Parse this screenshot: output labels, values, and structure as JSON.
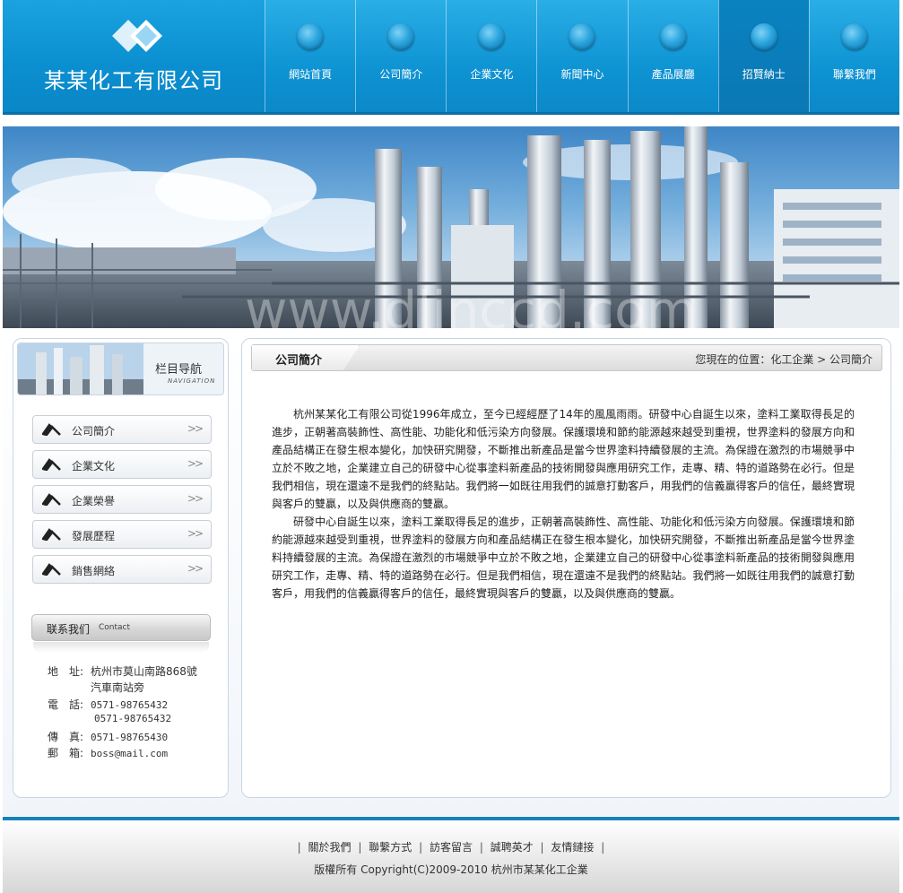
{
  "header": {
    "company_name": "某某化工有限公司",
    "nav": [
      {
        "label": "網站首頁"
      },
      {
        "label": "公司簡介"
      },
      {
        "label": "企業文化"
      },
      {
        "label": "新聞中心"
      },
      {
        "label": "產品展廳"
      },
      {
        "label": "招賢納士"
      },
      {
        "label": "聯繫我們"
      }
    ],
    "active_nav_index": 5
  },
  "banner": {
    "watermark": "www.dlinccd.com"
  },
  "sidebar": {
    "title": "栏目导航",
    "subtitle": "NAVIGATION",
    "menu": [
      {
        "label": "公司簡介",
        "arrow": ">>"
      },
      {
        "label": "企業文化",
        "arrow": ">>"
      },
      {
        "label": "企業榮譽",
        "arrow": ">>"
      },
      {
        "label": "發展歷程",
        "arrow": ">>"
      },
      {
        "label": "銷售網絡",
        "arrow": ">>"
      }
    ],
    "contact": {
      "title_cn": "联系我们",
      "title_en": "Contact",
      "address_key": "地　址:",
      "address_line1": "杭州市莫山南路868號",
      "address_line2": "汽車南站旁",
      "phone_key": "電　話:",
      "phone1": "0571-98765432",
      "phone2": "0571-98765432",
      "fax_key": "傳　真:",
      "fax": "0571-98765430",
      "email_key": "郵　箱:",
      "email": "boss@mail.com"
    }
  },
  "main": {
    "page_title": "公司簡介",
    "breadcrumb": "您現在的位置：化工企業 > 公司簡介",
    "paragraphs": [
      "杭州某某化工有限公司從1996年成立，至今已經經歷了14年的風風雨雨。研發中心自誕生以來，塗料工業取得長足的進步，正朝著高裝飾性、高性能、功能化和低污染方向發展。保護環境和節約能源越來越受到重視，世界塗料的發展方向和產品結構正在發生根本變化，加快研究開發，不斷推出新產品是當今世界塗料持續發展的主流。為保證在激烈的市場競爭中立於不敗之地，企業建立自己的研發中心從事塗料新產品的技術開發與應用研究工作，走專、精、特的道路勢在必行。但是我們相信，現在還遠不是我們的終點站。我們將一如既往用我們的誠意打動客戶，用我們的信義贏得客戶的信任，最終實現與客戶的雙贏，以及與供應商的雙贏。",
      "研發中心自誕生以來，塗料工業取得長足的進步，正朝著高裝飾性、高性能、功能化和低污染方向發展。保護環境和節約能源越來越受到重視，世界塗料的發展方向和產品結構正在發生根本變化，加快研究開發，不斷推出新產品是當今世界塗料持續發展的主流。為保證在激烈的市場競爭中立於不敗之地，企業建立自己的研發中心從事塗料新產品的技術開發與應用研究工作，走專、精、特的道路勢在必行。但是我們相信，現在還遠不是我們的終點站。我們將一如既往用我們的誠意打動客戶，用我們的信義贏得客戶的信任，最終實現與客戶的雙贏，以及與供應商的雙贏。"
    ]
  },
  "footer": {
    "links": [
      {
        "label": "關於我們"
      },
      {
        "label": "聯繫方式"
      },
      {
        "label": "訪客留言"
      },
      {
        "label": "誠聘英才"
      },
      {
        "label": "友情鏈接"
      }
    ],
    "separator": "|",
    "copyright": "版權所有 Copyright(C)2009-2010 杭州市某某化工企業"
  },
  "colors": {
    "header_blue": "#0b8fd0",
    "footer_line": "#1582b8"
  }
}
